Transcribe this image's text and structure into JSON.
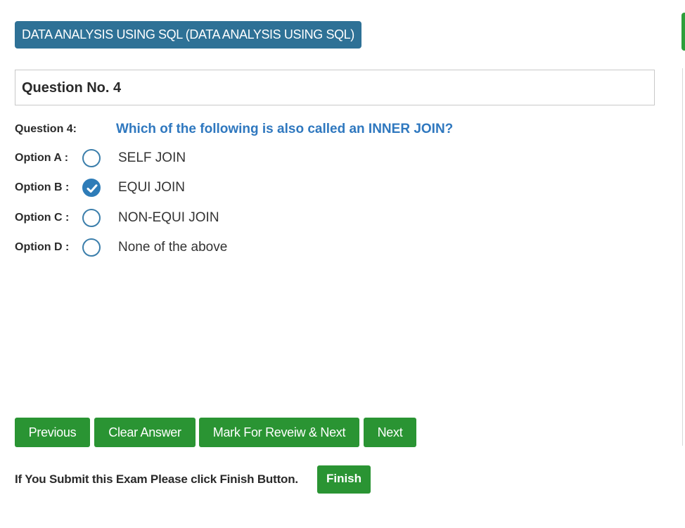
{
  "subject": {
    "title": "DATA ANALYSIS USING SQL (DATA ANALYSIS USING SQL)"
  },
  "question_box": {
    "title": "Question No. 4"
  },
  "question": {
    "label": "Question 4:",
    "text": "Which of the following is also called an INNER JOIN?"
  },
  "options": [
    {
      "label": "Option A :",
      "text": "SELF JOIN",
      "selected": false
    },
    {
      "label": "Option B :",
      "text": "EQUI JOIN",
      "selected": true
    },
    {
      "label": "Option C :",
      "text": "NON-EQUI JOIN",
      "selected": false
    },
    {
      "label": "Option D :",
      "text": "None of the above",
      "selected": false
    }
  ],
  "buttons": {
    "previous": "Previous",
    "clear": "Clear Answer",
    "mark_review": "Mark For Reveiw & Next",
    "next": "Next"
  },
  "finish": {
    "text": "If You Submit this Exam Please click Finish Button.",
    "button": "Finish"
  },
  "colors": {
    "badge": "#2e7196",
    "question_text": "#2f78bf",
    "button": "#2a9433",
    "radio": "#2e7cb8"
  },
  "icons": {
    "selected_option": "checkmark-icon"
  }
}
